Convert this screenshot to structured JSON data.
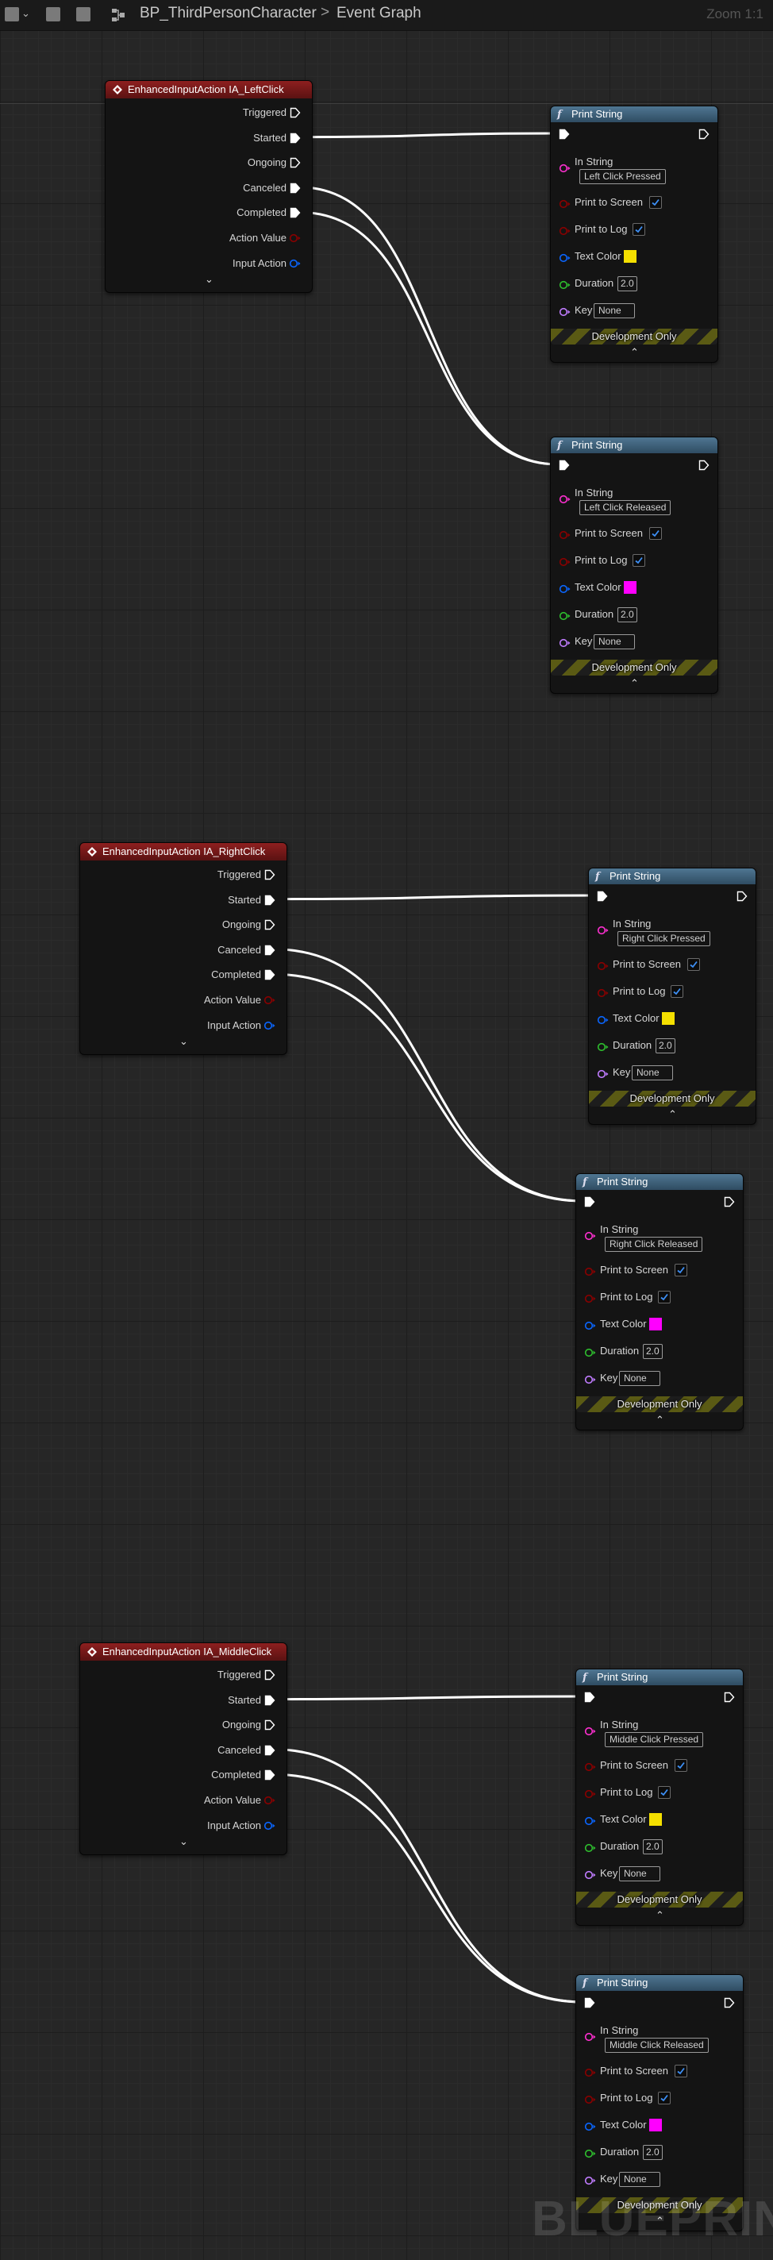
{
  "toolbar": {
    "blueprint_name": "BP_ThirdPersonCharacter",
    "graph_name": "Event Graph",
    "separator": ">",
    "zoom": "Zoom 1:1",
    "icons": [
      "blueprint-class-icon",
      "view-toggle-icon",
      "grid-icon",
      "dropdown-chevron-icon",
      "graph-icon"
    ]
  },
  "pins": {
    "triggered": "Triggered",
    "started": "Started",
    "ongoing": "Ongoing",
    "canceled": "Canceled",
    "completed": "Completed",
    "action_value": "Action Value",
    "input_action": "Input Action",
    "in_string": "In String",
    "print_to_screen": "Print to Screen",
    "print_to_log": "Print to Log",
    "text_color": "Text Color",
    "duration": "Duration",
    "key": "Key"
  },
  "print_title": "Print String",
  "dev_only": "Development Only",
  "events": [
    {
      "title": "EnhancedInputAction IA_LeftClick"
    },
    {
      "title": "EnhancedInputAction IA_RightClick"
    },
    {
      "title": "EnhancedInputAction IA_MiddleClick"
    }
  ],
  "prints": [
    {
      "in_string": "Left Click Pressed",
      "print_to_screen": true,
      "print_to_log": true,
      "text_color": "#f5e000",
      "duration": "2.0",
      "key": "None"
    },
    {
      "in_string": "Left Click Released",
      "print_to_screen": true,
      "print_to_log": true,
      "text_color": "#ff00ff",
      "duration": "2.0",
      "key": "None"
    },
    {
      "in_string": "Right Click Pressed",
      "print_to_screen": true,
      "print_to_log": true,
      "text_color": "#f5e000",
      "duration": "2.0",
      "key": "None"
    },
    {
      "in_string": "Right Click Released",
      "print_to_screen": true,
      "print_to_log": true,
      "text_color": "#ff00ff",
      "duration": "2.0",
      "key": "None"
    },
    {
      "in_string": "Middle Click Pressed",
      "print_to_screen": true,
      "print_to_log": true,
      "text_color": "#f5e000",
      "duration": "2.0",
      "key": "None"
    },
    {
      "in_string": "Middle Click Released",
      "print_to_screen": true,
      "print_to_log": true,
      "text_color": "#ff00ff",
      "duration": "2.0",
      "key": "None"
    }
  ],
  "colors": {
    "event_header": "#8e1f1f",
    "function_header": "#4f7692",
    "exec_wire": "#ffffff",
    "string_pin": "#ff2fd1",
    "bool_pin": "#8a0000",
    "color_pin": "#0a66ff",
    "float_pin": "#2ebe2e",
    "key_pin": "#c07cff"
  },
  "watermark": "BLUEPRINT"
}
